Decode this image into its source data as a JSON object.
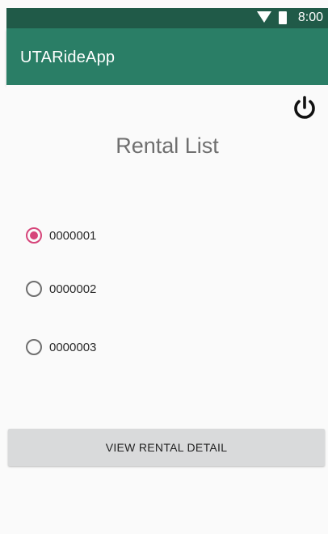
{
  "status_bar": {
    "time": "8:00",
    "icons": [
      "wifi-icon",
      "battery-icon"
    ]
  },
  "app_bar": {
    "title": "UTARideApp",
    "color": "#2a7e66",
    "status_color": "#205a48"
  },
  "toolbar": {
    "power_icon": "power-icon"
  },
  "page": {
    "title": "Rental List"
  },
  "rentals": [
    {
      "label": "0000001",
      "selected": true
    },
    {
      "label": "0000002",
      "selected": false
    },
    {
      "label": "0000003",
      "selected": false
    }
  ],
  "actions": {
    "view_detail_label": "VIEW RENTAL DETAIL"
  },
  "colors": {
    "accent": "#d6457a"
  }
}
